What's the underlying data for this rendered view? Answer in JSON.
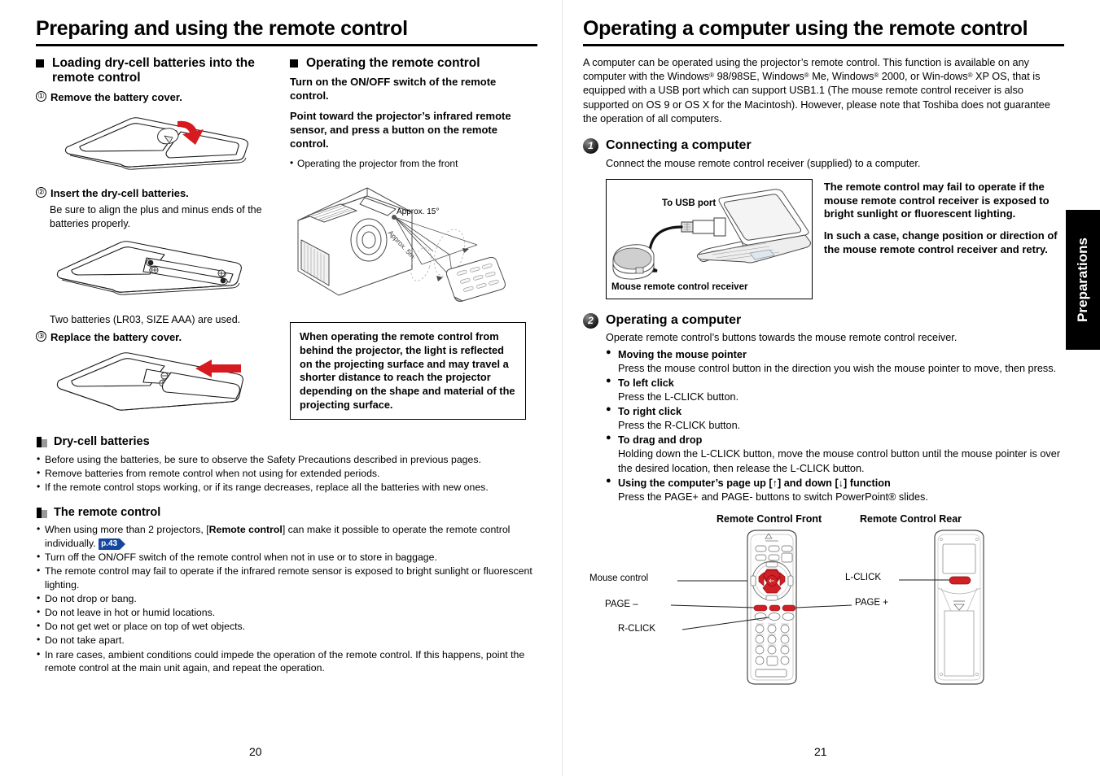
{
  "left_page": {
    "title": "Preparing and using the remote control",
    "page_number": "20",
    "section_loading": {
      "heading": "Loading dry-cell batteries into the remote control",
      "step1": {
        "num": "①",
        "text": "Remove the battery cover."
      },
      "step2": {
        "num": "②",
        "text": "Insert the dry-cell batteries.",
        "detail": "Be sure to align the plus and minus ends of the batteries properly.",
        "note": "Two batteries (LR03, SIZE AAA) are used."
      },
      "step3": {
        "num": "③",
        "text": "Replace the battery cover."
      }
    },
    "section_operating": {
      "heading": "Operating the remote control",
      "para1": "Turn on the ON/OFF switch of the remote control.",
      "para2": "Point toward the projector’s infrared remote sensor, and press a button on the remote control.",
      "bullet": "Operating the projector from the front",
      "figure_labels": {
        "angle": "Approx. 15°",
        "distance": "Approx. 5m"
      },
      "notebox": "When operating the remote control from behind the projector, the light is reflected on the projecting surface and may travel a shorter distance to reach the projector depending on the shape and material of the projecting surface."
    },
    "section_drycell": {
      "heading": "Dry-cell batteries",
      "items": [
        "Before using the batteries, be sure to observe the Safety Precautions described in previous pages.",
        "Remove batteries from remote control when not using for extended periods.",
        "If the remote control stops working, or if its range decreases, replace all the batteries with new ones."
      ]
    },
    "section_remote": {
      "heading": "The remote control",
      "item1_pre": "When using more than 2 projectors, [",
      "item1_bold": "Remote control",
      "item1_post": "] can make it possible to operate the remote control individually.",
      "page_ref": "p.43",
      "items": [
        "Turn off the ON/OFF switch of the remote control when not in use or to store in baggage.",
        "The remote control may fail to operate if the infrared remote sensor is exposed to bright sunlight or fluorescent lighting.",
        "Do not drop or bang.",
        "Do not leave in hot or humid locations.",
        "Do not get wet or place on top of wet objects.",
        "Do not take apart.",
        "In rare cases, ambient conditions could impede the operation of the remote control. If this happens, point the remote control at the main unit again, and repeat the operation."
      ]
    }
  },
  "right_page": {
    "title": "Operating a computer using the remote control",
    "page_number": "21",
    "intro_parts": {
      "p1": "A computer can be operated using the projector’s remote control.  This function is available on any computer with the Windows",
      "r1": "®",
      "p2": " 98/98SE, Windows",
      "r2": "®",
      "p3": " Me, Windows",
      "r3": "®",
      "p4": " 2000, or Win-dows",
      "r4": "®",
      "p5": " XP OS, that is equipped with a USB port which can support USB1.1 (The mouse remote control receiver is also supported on OS 9 or OS X for the Macintosh).  However, please note that Toshiba does not guarantee the operation of all computers."
    },
    "section1": {
      "number": "1",
      "heading": "Connecting a computer",
      "body": "Connect the mouse remote control receiver (supplied) to a computer.",
      "diagram_labels": {
        "usb": "To USB port",
        "receiver": "Mouse remote control receiver"
      },
      "warning1": "The remote control may fail to operate if the mouse remote control receiver is exposed to bright sunlight or fluorescent lighting.",
      "warning2": "In such a case, change position or direction of the mouse remote control receiver and retry."
    },
    "section2": {
      "number": "2",
      "heading": "Operating a computer",
      "body": "Operate remote control’s buttons towards the mouse remote control receiver.",
      "bullets": [
        {
          "head": "Moving the mouse pointer",
          "body": "Press the mouse control button in the direction you wish the mouse pointer to move, then press."
        },
        {
          "head": "To left click",
          "body": "Press the L-CLICK button."
        },
        {
          "head": "To right click",
          "body": "Press the R-CLICK button."
        },
        {
          "head": "To drag and drop",
          "body": "Holding down the L-CLICK button, move the mouse control button until the mouse pointer is over the desired location, then release the L-CLICK button."
        },
        {
          "head": "Using the computer’s page up [↑] and down [↓] function",
          "body": "Press the PAGE+ and PAGE- buttons to switch PowerPoint® slides."
        }
      ]
    },
    "remote_figure": {
      "caption_front": "Remote Control Front",
      "caption_rear": "Remote Control Rear",
      "label_mouse_control": "Mouse control",
      "label_page_minus": "PAGE –",
      "label_page_plus": "PAGE +",
      "label_rclick": "R-CLICK",
      "label_lclick": "L-CLICK"
    }
  },
  "side_tab": {
    "label": "Preparations"
  },
  "colors": {
    "accent_red": "#d71920",
    "badge_blue": "#1447a0",
    "tab_black": "#000000"
  }
}
